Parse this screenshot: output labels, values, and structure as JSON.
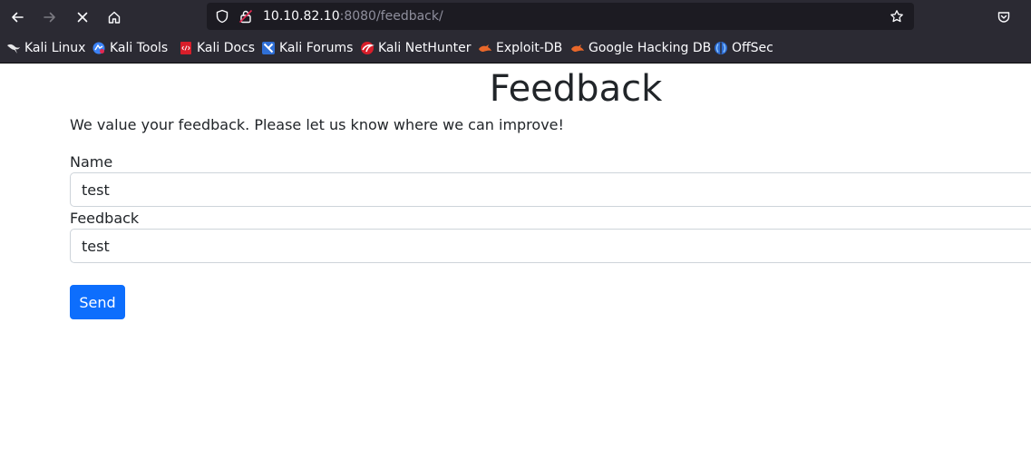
{
  "browser": {
    "url_host": "10.10.82.10",
    "url_rest": ":8080/feedback/",
    "bookmarks": [
      {
        "label": "Kali Linux",
        "icon": "kali-dragon-icon"
      },
      {
        "label": "Kali Tools",
        "icon": "kali-tools-icon"
      },
      {
        "label": "Kali Docs",
        "icon": "kali-docs-icon"
      },
      {
        "label": "Kali Forums",
        "icon": "kali-forums-icon"
      },
      {
        "label": "Kali NetHunter",
        "icon": "kali-nethunter-icon"
      },
      {
        "label": "Exploit-DB",
        "icon": "exploit-db-icon"
      },
      {
        "label": "Google Hacking DB",
        "icon": "ghdb-icon"
      },
      {
        "label": "OffSec",
        "icon": "offsec-icon"
      }
    ],
    "colors": {
      "chrome": "#2b2a33",
      "urlbar": "#1c1b22"
    }
  },
  "page": {
    "title": "Feedback",
    "intro": "We value your feedback. Please let us know where we can improve!",
    "form": {
      "name_label": "Name",
      "name_value": "test",
      "feedback_label": "Feedback",
      "feedback_value": "test",
      "send_label": "Send"
    },
    "colors": {
      "primary": "#0d6efd",
      "text": "#212529"
    }
  }
}
